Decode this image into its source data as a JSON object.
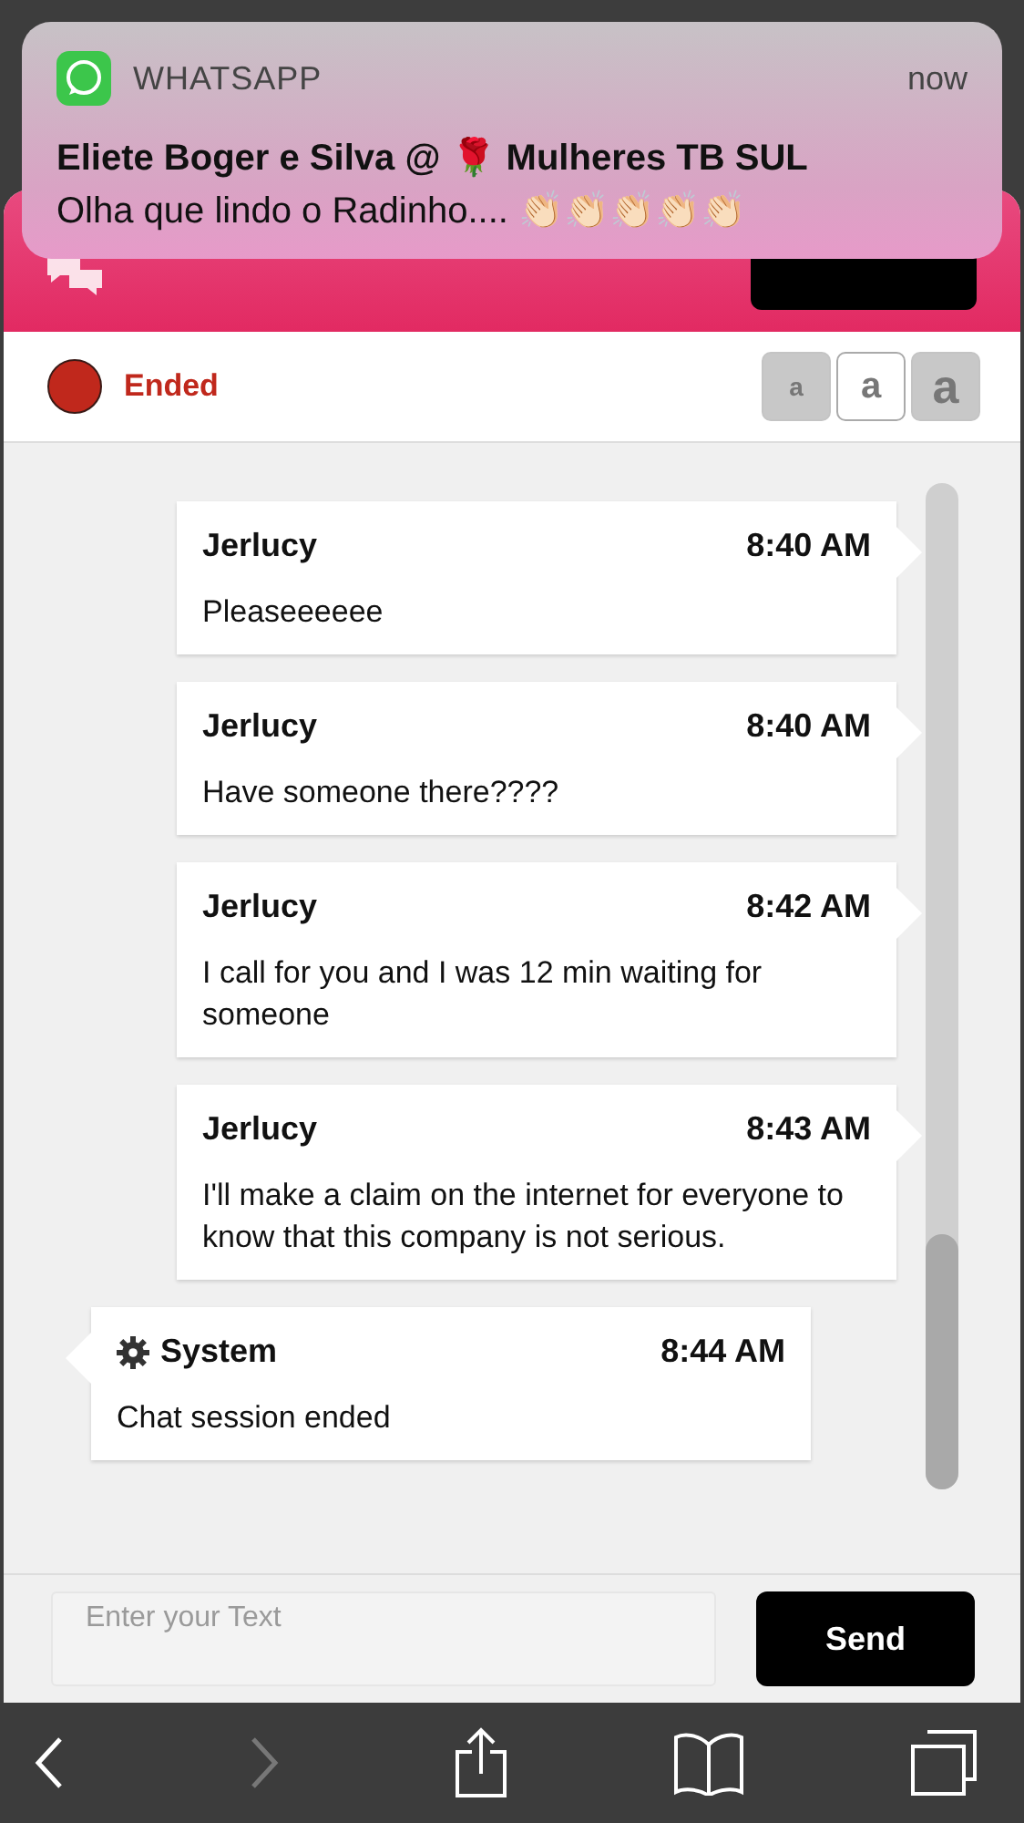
{
  "notification": {
    "app": "WHATSAPP",
    "time": "now",
    "title": "Eliete Boger e Silva @ 🌹 Mulheres TB SUL",
    "body": "Olha que lindo o Radinho.... 👏🏻👏🏻👏🏻👏🏻👏🏻"
  },
  "status": {
    "label": "Ended",
    "color": "#c0281c"
  },
  "font_sizes": [
    {
      "label": "a",
      "selected": false
    },
    {
      "label": "a",
      "selected": true
    },
    {
      "label": "a",
      "selected": false
    }
  ],
  "messages": [
    {
      "kind": "visitor",
      "author": "Jerlucy",
      "time": "8:40 AM",
      "text": "Pleaseeeeee"
    },
    {
      "kind": "visitor",
      "author": "Jerlucy",
      "time": "8:40 AM",
      "text": "Have someone there????"
    },
    {
      "kind": "visitor",
      "author": "Jerlucy",
      "time": "8:42 AM",
      "text": "I call for you and I was 12 min waiting for someone"
    },
    {
      "kind": "visitor",
      "author": "Jerlucy",
      "time": "8:43 AM",
      "text": "I'll make a claim on the internet for everyone to know that this company is not serious."
    },
    {
      "kind": "system",
      "author": "System",
      "time": "8:44 AM",
      "text": "Chat session ended"
    }
  ],
  "composer": {
    "placeholder": "Enter your Text",
    "send": "Send"
  },
  "toolbar": [
    {
      "kind": "back",
      "disabled": false
    },
    {
      "kind": "forward",
      "disabled": true
    },
    {
      "kind": "share",
      "disabled": false
    },
    {
      "kind": "bookmarks",
      "disabled": false
    },
    {
      "kind": "tabs",
      "disabled": false
    }
  ]
}
